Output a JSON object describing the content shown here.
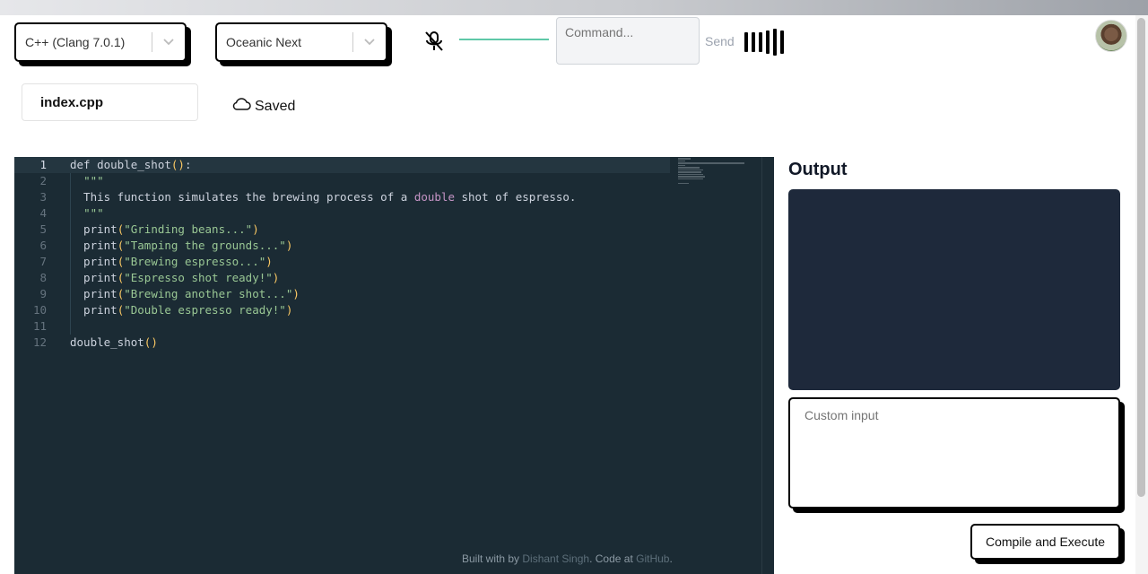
{
  "toolbar": {
    "language": "C++ (Clang 7.0.1)",
    "theme": "Oceanic Next",
    "command_placeholder": "Command...",
    "send_label": "Send"
  },
  "file": {
    "name": "index.cpp",
    "status": "Saved"
  },
  "editor": {
    "active_line": 1,
    "lines": [
      {
        "n": "1",
        "text": "def double_shot():"
      },
      {
        "n": "2",
        "text": "  \"\"\""
      },
      {
        "n": "3",
        "text": "  This function simulates the brewing process of a double shot of espresso."
      },
      {
        "n": "4",
        "text": "  \"\"\""
      },
      {
        "n": "5",
        "text": "  print(\"Grinding beans...\")"
      },
      {
        "n": "6",
        "text": "  print(\"Tamping the grounds...\")"
      },
      {
        "n": "7",
        "text": "  print(\"Brewing espresso...\")"
      },
      {
        "n": "8",
        "text": "  print(\"Espresso shot ready!\")"
      },
      {
        "n": "9",
        "text": "  print(\"Brewing another shot...\")"
      },
      {
        "n": "10",
        "text": "  print(\"Double espresso ready!\")"
      },
      {
        "n": "11",
        "text": ""
      },
      {
        "n": "12",
        "text": "double_shot()"
      }
    ]
  },
  "footer": {
    "prefix": "Built with by ",
    "author": "Dishant Singh",
    "middle": ". Code at ",
    "repo": "GitHub",
    "suffix": "."
  },
  "output": {
    "title": "Output",
    "custom_input_placeholder": "Custom input",
    "compile_label": "Compile and Execute"
  },
  "colors": {
    "editor_bg": "#1b2b34",
    "output_bg": "#1e293b",
    "string": "#99c794",
    "paren": "#fac863",
    "keyword_highlight": "#c594c5"
  }
}
